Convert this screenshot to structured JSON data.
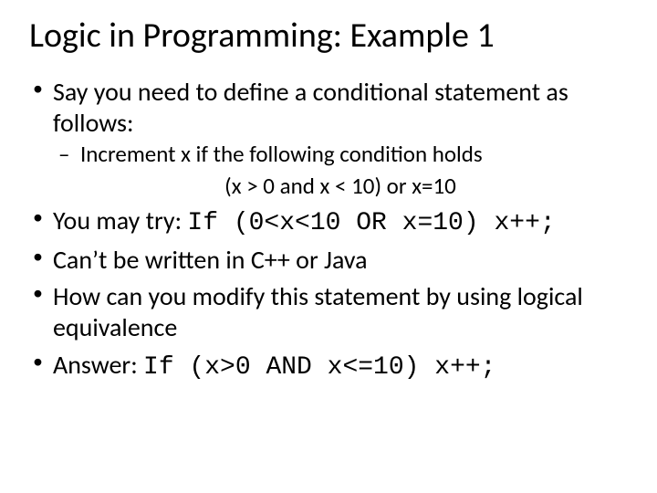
{
  "title": "Logic in Programming: Example 1",
  "b1": "Say you need to define a conditional statement as follows:",
  "sub1": "Increment x if the following condition holds",
  "cond": "(x > 0 and x < 10) or x=10",
  "b2_label": "You may try: ",
  "b2_code": "If (0<x<10 OR x=10) x++;",
  "b3": "Can’t be written in C++ or Java",
  "b4": "How can you modify this statement by using logical equivalence",
  "b5_label": "Answer: ",
  "b5_code": "If (x>0 AND x<=10) x++;"
}
